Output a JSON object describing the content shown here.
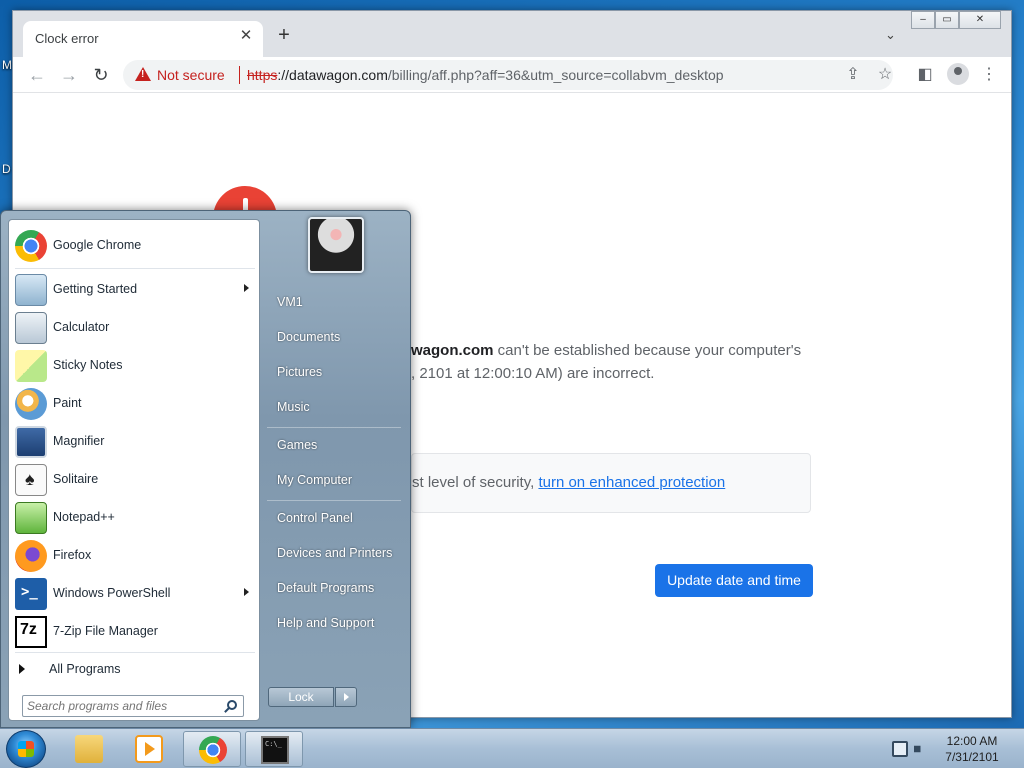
{
  "desktop": {
    "edge_fragments": [
      "M",
      "D"
    ]
  },
  "browser": {
    "tab_title": "Clock error",
    "tab_close": "✕",
    "new_tab": "+",
    "tab_search": "⌄",
    "window_buttons": {
      "minimize": "–",
      "maximize": "▭",
      "close": "✕"
    },
    "nav": {
      "back": "←",
      "forward": "→",
      "reload": "↻"
    },
    "security_label": "Not secure",
    "url_scheme": "https",
    "url_host": "://datawagon.com",
    "url_path": "/billing/aff.php?aff=36&utm_source=collabvm_desktop",
    "toolbar_icons": {
      "share": "⇪",
      "bookmark": "☆",
      "sidepanel": "◧",
      "menu": "⋮"
    }
  },
  "error_page": {
    "message_host": "wagon.com",
    "message_line1": " can't be established because your computer's",
    "message_line2": ", 2101 at 12:00:10 AM) are incorrect.",
    "protection_text": "st level of security, ",
    "protection_link": "turn on enhanced protection",
    "update_button": "Update date and time"
  },
  "start_menu": {
    "pinned": [
      {
        "label": "Google Chrome",
        "icon": "chrome-icon"
      }
    ],
    "programs": [
      {
        "label": "Getting Started",
        "icon": "getting-started-icon",
        "submenu": true
      },
      {
        "label": "Calculator",
        "icon": "calculator-icon",
        "submenu": false
      },
      {
        "label": "Sticky Notes",
        "icon": "sticky-notes-icon",
        "submenu": false
      },
      {
        "label": "Paint",
        "icon": "paint-icon",
        "submenu": false
      },
      {
        "label": "Magnifier",
        "icon": "magnifier-icon",
        "submenu": false
      },
      {
        "label": "Solitaire",
        "icon": "solitaire-icon",
        "submenu": false
      },
      {
        "label": "Notepad++",
        "icon": "notepadpp-icon",
        "submenu": false
      },
      {
        "label": "Firefox",
        "icon": "firefox-icon",
        "submenu": false
      },
      {
        "label": "Windows PowerShell",
        "icon": "powershell-icon",
        "submenu": true
      },
      {
        "label": "7-Zip File Manager",
        "icon": "7zip-icon",
        "submenu": false
      }
    ],
    "all_programs": "All Programs",
    "search_placeholder": "Search programs and files",
    "right_items": [
      {
        "label": "VM1"
      },
      {
        "label": "Documents"
      },
      {
        "label": "Pictures"
      },
      {
        "label": "Music"
      },
      {
        "label": "Games"
      },
      {
        "label": "My Computer"
      },
      {
        "label": "Control Panel"
      },
      {
        "label": "Devices and Printers"
      },
      {
        "label": "Default Programs"
      },
      {
        "label": "Help and Support"
      }
    ],
    "lock_button": "Lock"
  },
  "taskbar": {
    "apps": [
      {
        "name": "explorer",
        "icon": "folder-icon"
      },
      {
        "name": "media-player",
        "icon": "media-player-icon"
      },
      {
        "name": "chrome",
        "icon": "chrome-icon",
        "active": true
      },
      {
        "name": "cmd",
        "icon": "cmd-icon"
      }
    ],
    "time": "12:00 AM",
    "date": "7/31/2101"
  },
  "colors": {
    "accent_blue": "#1a73e8",
    "warning_red": "#c5221f",
    "error_icon_red": "#e94235"
  }
}
